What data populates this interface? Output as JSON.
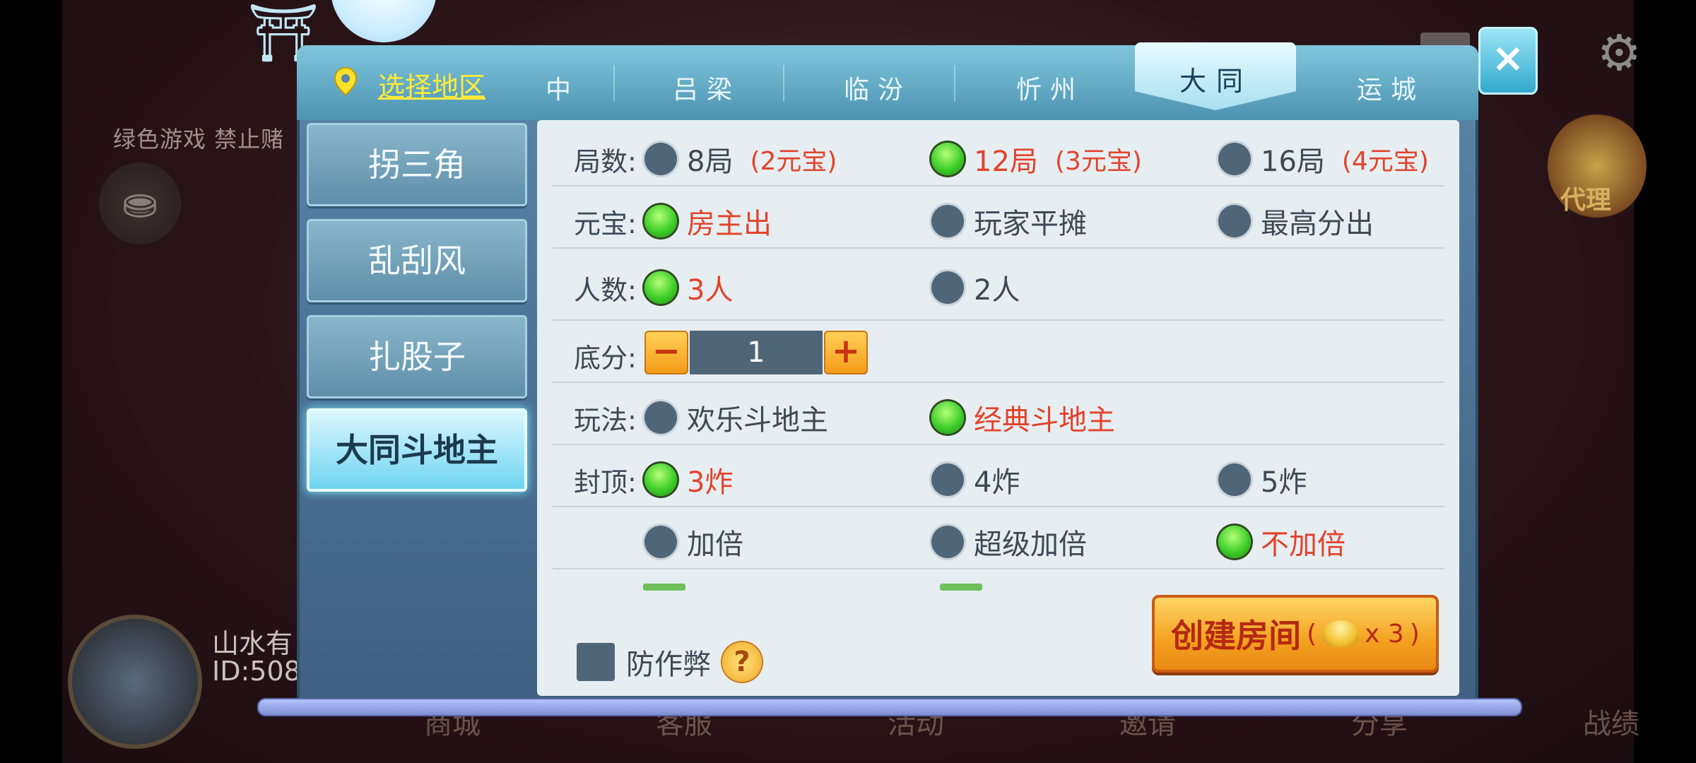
{
  "background": {
    "notice_text": "绿色游戏 禁止赌",
    "player_name": "山水有",
    "player_id": "ID:508",
    "bottom_nav": [
      "商城",
      "客服",
      "活动",
      "邀请",
      "分享",
      "战绩"
    ],
    "agent_label": "代理"
  },
  "header": {
    "region_link": "选择地区",
    "tabs": [
      {
        "label": "中"
      },
      {
        "label": "吕梁"
      },
      {
        "label": "临汾"
      },
      {
        "label": "忻州"
      },
      {
        "label": "大同",
        "active": true
      },
      {
        "label": "运城"
      }
    ],
    "close_label": "×"
  },
  "games": [
    {
      "label": "拐三角"
    },
    {
      "label": "乱刮风"
    },
    {
      "label": "扎股子"
    },
    {
      "label": "大同斗地主",
      "active": true
    }
  ],
  "settings": {
    "rounds": {
      "label": "局数:",
      "options": [
        {
          "text": "8局",
          "price": "(2元宝)",
          "selected": false
        },
        {
          "text": "12局",
          "price": "(3元宝)",
          "selected": true
        },
        {
          "text": "16局",
          "price": "(4元宝)",
          "selected": false
        }
      ]
    },
    "payment": {
      "label": "元宝:",
      "options": [
        {
          "text": "房主出",
          "selected": true
        },
        {
          "text": "玩家平摊",
          "selected": false
        },
        {
          "text": "最高分出",
          "selected": false
        }
      ]
    },
    "players": {
      "label": "人数:",
      "options": [
        {
          "text": "3人",
          "selected": true
        },
        {
          "text": "2人",
          "selected": false
        }
      ]
    },
    "base_score": {
      "label": "底分:",
      "value": "1",
      "minus": "−",
      "plus": "+"
    },
    "mode": {
      "label": "玩法:",
      "options": [
        {
          "text": "欢乐斗地主",
          "selected": false
        },
        {
          "text": "经典斗地主",
          "selected": true
        }
      ]
    },
    "cap": {
      "label": "封顶:",
      "options": [
        {
          "text": "3炸",
          "selected": true
        },
        {
          "text": "4炸",
          "selected": false
        },
        {
          "text": "5炸",
          "selected": false
        }
      ]
    },
    "double": {
      "options": [
        {
          "text": "加倍",
          "selected": false
        },
        {
          "text": "超级加倍",
          "selected": false
        },
        {
          "text": "不加倍",
          "selected": true
        }
      ]
    },
    "anti_cheat_label": "防作弊",
    "help_label": "?"
  },
  "create_button": {
    "label": "创建房间",
    "cost_prefix": "(",
    "cost": "x 3",
    "cost_suffix": ")"
  },
  "colors": {
    "accent_red": "#e2432b",
    "radio_on": "#3fcf2a",
    "radio_off": "#4f6678",
    "tab_bar": "#5aa3c2"
  }
}
